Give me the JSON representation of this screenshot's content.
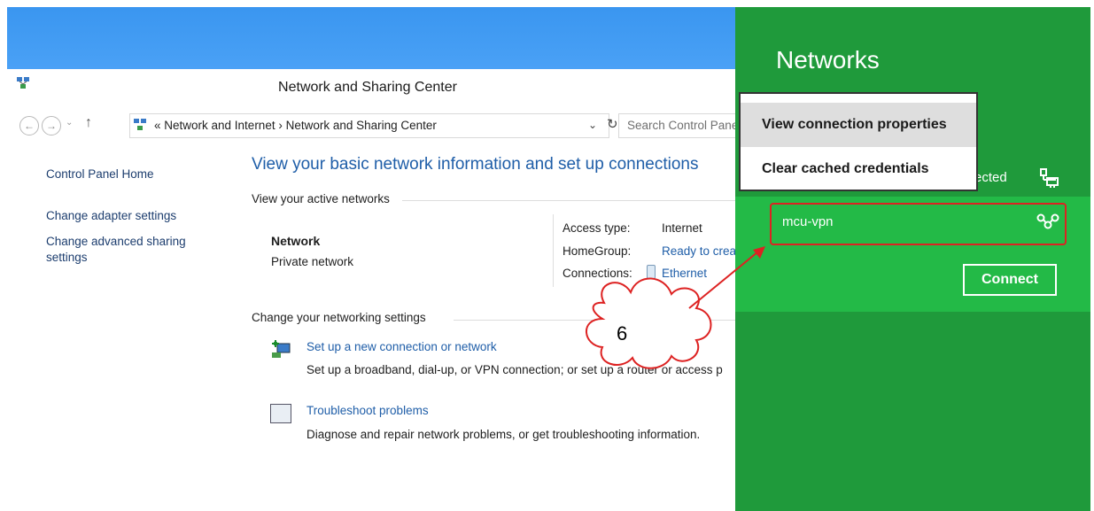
{
  "window": {
    "title": "Network and Sharing Center"
  },
  "address_bar": {
    "path": "« Network and Internet  ›  Network and Sharing Center",
    "search_placeholder": "Search Control Pane"
  },
  "sidebar": {
    "items": [
      {
        "label": "Control Panel Home"
      },
      {
        "label": "Change adapter settings"
      },
      {
        "label": "Change advanced sharing settings"
      }
    ]
  },
  "main": {
    "heading": "View your basic network information and set up connections",
    "active_networks_label": "View your active networks",
    "network": {
      "name": "Network",
      "type": "Private network",
      "access_type_label": "Access type:",
      "access_type_value": "Internet",
      "homegroup_label": "HomeGroup:",
      "homegroup_value": "Ready to crea",
      "connections_label": "Connections:",
      "connections_value": "Ethernet"
    },
    "change_settings_label": "Change your networking settings",
    "tasks": [
      {
        "link": "Set up a new connection or network",
        "desc": "Set up a broadband, dial-up, or VPN connection; or set up a router or access p",
        "icon": "new-connection-icon"
      },
      {
        "link": "Troubleshoot problems",
        "desc": "Diagnose and repair network problems, or get troubleshooting information.",
        "icon": "troubleshoot-icon"
      }
    ]
  },
  "charm": {
    "title": "Networks",
    "connection_partial": "ected",
    "vpn_name": "mcu-vpn",
    "connect_label": "Connect",
    "accent": "#1f9a3b",
    "highlight": "#23ba47"
  },
  "context_menu": {
    "items": [
      {
        "label": "View connection properties"
      },
      {
        "label": "Clear cached credentials"
      }
    ]
  },
  "annotation": {
    "number": "6",
    "color": "#dd2222"
  }
}
